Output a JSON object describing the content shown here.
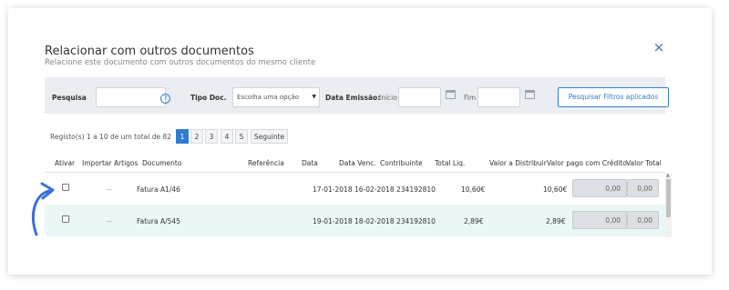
{
  "modal": {
    "title": "Relacionar com outros documentos",
    "subtitle": "Relacione este documento com outros documentos do mesmo cliente",
    "close_icon": "×"
  },
  "filters": {
    "search_label": "Pesquisa",
    "search_value": "",
    "help_icon": "?",
    "doc_type_label": "Tipo Doc.",
    "doc_type_selected": "Escolha uma opção",
    "date_label": "Data Emissão:",
    "start_label": "Início",
    "start_value": "",
    "end_label": "Fim",
    "end_value": "",
    "apply_button": "Pesquisar Filtros aplicados"
  },
  "pagination": {
    "records_text": "Registo(s) 1 a 10 de um total de 82",
    "pages": [
      "1",
      "2",
      "3",
      "4",
      "5"
    ],
    "active_page": "1",
    "next_label": "Seguinte"
  },
  "table": {
    "columns": [
      "Ativar",
      "Importar Artigos",
      "Documento",
      "Referência",
      "Data",
      "Data Venc.",
      "Contribuinte",
      "Total Liq.",
      "Valor a Distribuir",
      "Valor pago com Crédito",
      "Valor Total"
    ],
    "rows": [
      {
        "importar": "--",
        "documento": "Fatura A1/46",
        "referencia": "",
        "data": "17-01-2018",
        "data_venc": "16-02-2018",
        "contribuinte": "234192810",
        "total_liq": "10,60€",
        "valor_distribuir": "10,60€",
        "valor_pago_credito": "0,00",
        "valor_total": "0,00"
      },
      {
        "importar": "--",
        "documento": "Fatura A/545",
        "referencia": "",
        "data": "19-01-2018",
        "data_venc": "18-02-2018",
        "contribuinte": "234192810",
        "total_liq": "2,89€",
        "valor_distribuir": "2,89€",
        "valor_pago_credito": "0,00",
        "valor_total": "0,00"
      }
    ]
  },
  "colors": {
    "accent": "#2e7dd1",
    "row_alt": "#ebf6f7",
    "filter_bg": "#eaedf1",
    "arrow": "#3a6fd6"
  }
}
